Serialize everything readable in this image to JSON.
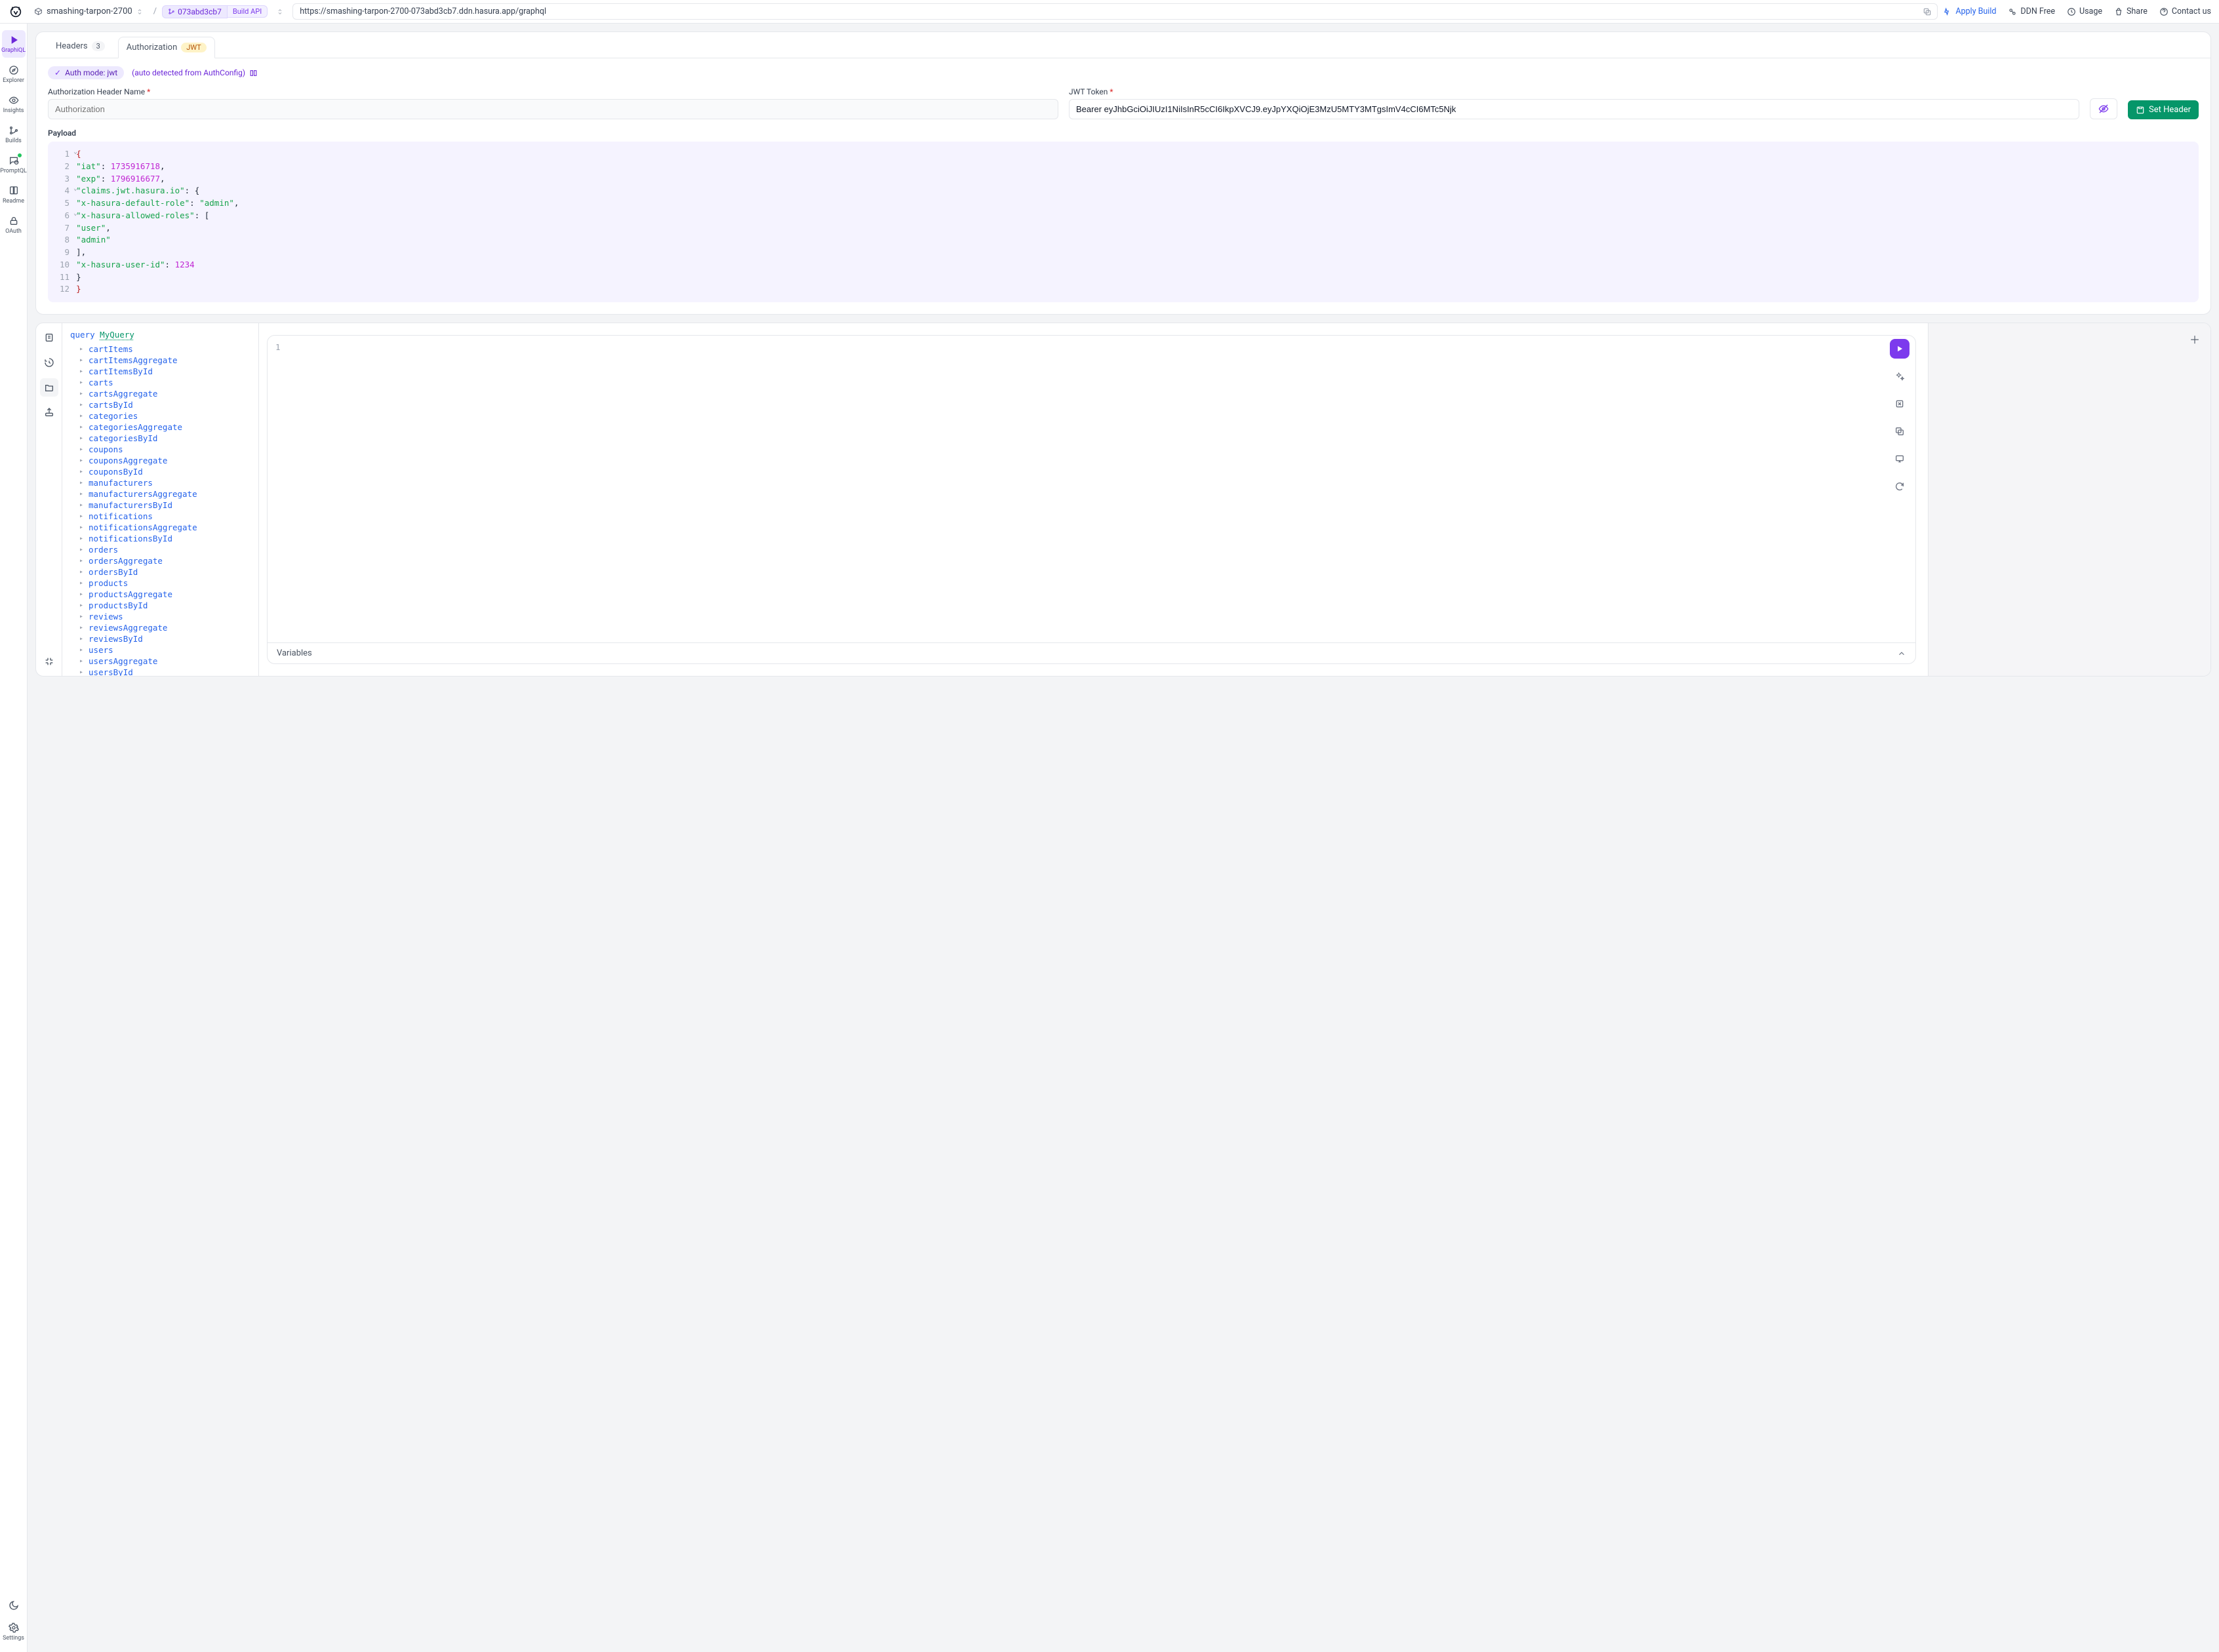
{
  "header": {
    "project_name": "smashing-tarpon-2700",
    "branch_id": "073abd3cb7",
    "build_api_label": "Build API",
    "url": "https://smashing-tarpon-2700-073abd3cb7.ddn.hasura.app/graphql",
    "links": {
      "apply_build": "Apply Build",
      "ddn_free": "DDN Free",
      "usage": "Usage",
      "share": "Share",
      "contact": "Contact us"
    }
  },
  "leftnav": {
    "graphiql": "GraphiQL",
    "explorer": "Explorer",
    "insights": "Insights",
    "builds": "Builds",
    "promptql": "PromptQL",
    "readme": "Readme",
    "oauth": "OAuth",
    "settings": "Settings"
  },
  "auth_card": {
    "tabs": {
      "headers_label": "Headers",
      "headers_count": "3",
      "auth_label": "Authorization",
      "auth_badge": "JWT"
    },
    "auth_mode_pill": "Auth mode: jwt",
    "auto_detected": "(auto detected from AuthConfig)",
    "header_name_label": "Authorization Header Name",
    "header_name_placeholder": "Authorization",
    "jwt_label": "JWT Token",
    "jwt_value": "Bearer eyJhbGciOiJIUzI1NiIsInR5cCI6IkpXVCJ9.eyJpYXQiOjE3MzU5MTY3MTgsImV4cCI6MTc5Njk",
    "set_header_btn": "Set Header",
    "payload_title": "Payload",
    "payload_lines": [
      [
        {
          "t": "{",
          "c": "punc2"
        }
      ],
      [
        {
          "t": "  ",
          "c": ""
        },
        {
          "t": "\"iat\"",
          "c": "key"
        },
        {
          "t": ": ",
          "c": "punc"
        },
        {
          "t": "1735916718",
          "c": "num"
        },
        {
          "t": ",",
          "c": "punc"
        }
      ],
      [
        {
          "t": "  ",
          "c": ""
        },
        {
          "t": "\"exp\"",
          "c": "key"
        },
        {
          "t": ": ",
          "c": "punc"
        },
        {
          "t": "1796916677",
          "c": "num"
        },
        {
          "t": ",",
          "c": "punc"
        }
      ],
      [
        {
          "t": "  ",
          "c": ""
        },
        {
          "t": "\"claims.jwt.hasura.io\"",
          "c": "key"
        },
        {
          "t": ": {",
          "c": "punc"
        }
      ],
      [
        {
          "t": "    ",
          "c": ""
        },
        {
          "t": "\"x-hasura-default-role\"",
          "c": "key"
        },
        {
          "t": ": ",
          "c": "punc"
        },
        {
          "t": "\"admin\"",
          "c": "str"
        },
        {
          "t": ",",
          "c": "punc"
        }
      ],
      [
        {
          "t": "    ",
          "c": ""
        },
        {
          "t": "\"x-hasura-allowed-roles\"",
          "c": "key"
        },
        {
          "t": ": [",
          "c": "punc"
        }
      ],
      [
        {
          "t": "      ",
          "c": ""
        },
        {
          "t": "\"user\"",
          "c": "str"
        },
        {
          "t": ",",
          "c": "punc"
        }
      ],
      [
        {
          "t": "      ",
          "c": ""
        },
        {
          "t": "\"admin\"",
          "c": "str"
        }
      ],
      [
        {
          "t": "    ],",
          "c": "punc"
        }
      ],
      [
        {
          "t": "    ",
          "c": ""
        },
        {
          "t": "\"x-hasura-user-id\"",
          "c": "key"
        },
        {
          "t": ": ",
          "c": "punc"
        },
        {
          "t": "1234",
          "c": "num"
        }
      ],
      [
        {
          "t": "  }",
          "c": "punc"
        }
      ],
      [
        {
          "t": "}",
          "c": "punc2"
        }
      ]
    ],
    "fold_line_indices": [
      0,
      3,
      5
    ]
  },
  "query_section": {
    "query_keyword": "query",
    "query_name": "MyQuery",
    "fields": [
      "cartItems",
      "cartItemsAggregate",
      "cartItemsById",
      "carts",
      "cartsAggregate",
      "cartsById",
      "categories",
      "categoriesAggregate",
      "categoriesById",
      "coupons",
      "couponsAggregate",
      "couponsById",
      "manufacturers",
      "manufacturersAggregate",
      "manufacturersById",
      "notifications",
      "notificationsAggregate",
      "notificationsById",
      "orders",
      "ordersAggregate",
      "ordersById",
      "products",
      "productsAggregate",
      "productsById",
      "reviews",
      "reviewsAggregate",
      "reviewsById",
      "users",
      "usersAggregate",
      "usersById"
    ],
    "editor_line": "1",
    "variables_label": "Variables"
  }
}
